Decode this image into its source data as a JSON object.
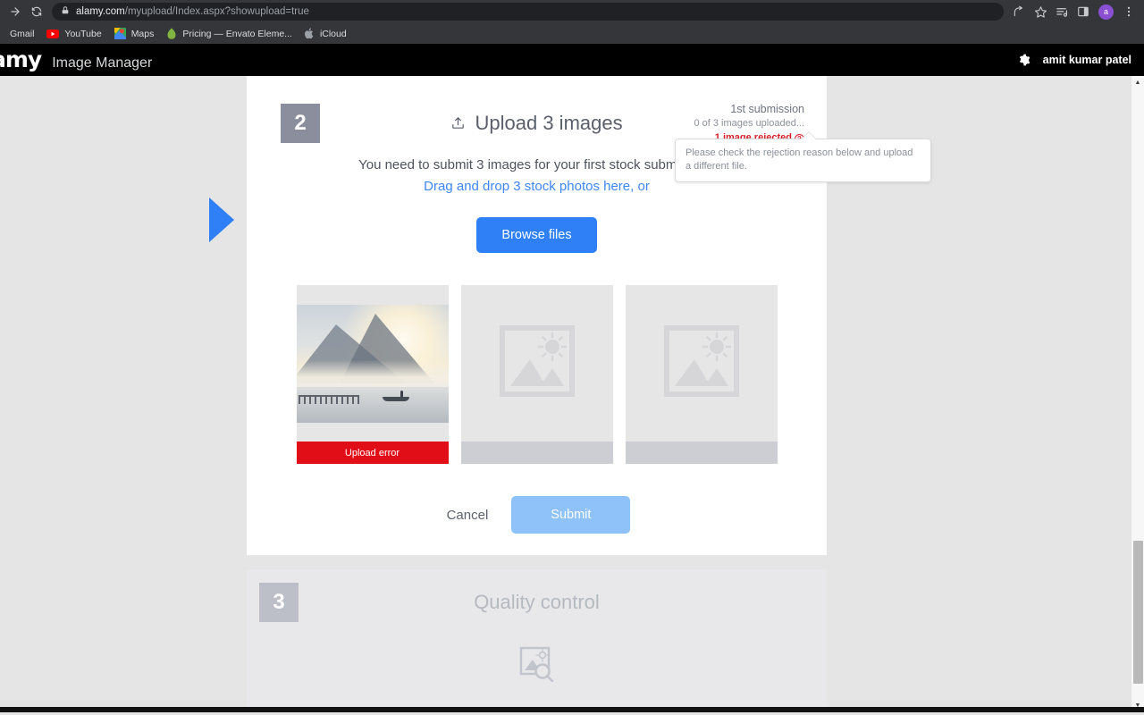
{
  "browser": {
    "nav": {
      "forward_icon": "arrow-right-icon",
      "reload_icon": "reload-icon"
    },
    "omnibox": {
      "lock_icon": "lock-icon",
      "url_domain": "alamy.com",
      "url_path": "/myupload/Index.aspx?showupload=true"
    },
    "toolbar_icons": [
      "share-icon",
      "bookmark-star-icon",
      "reading-list-icon",
      "side-panel-icon"
    ],
    "profile_initial": "a",
    "menu_icon": "three-dot-menu-icon",
    "bookmarks": [
      {
        "label": "Gmail",
        "icon": "gmail-icon"
      },
      {
        "label": "YouTube",
        "icon": "youtube-icon"
      },
      {
        "label": "Maps",
        "icon": "google-maps-icon"
      },
      {
        "label": "Pricing — Envato Eleme...",
        "icon": "envato-icon"
      },
      {
        "label": "iCloud",
        "icon": "apple-icon"
      }
    ]
  },
  "app_header": {
    "logo_text": "amy",
    "app_name": "Image Manager",
    "gear_icon": "gear-icon",
    "user_name": "amit kumar patel"
  },
  "step2": {
    "badge": "2",
    "upload_icon": "upload-icon",
    "title": "Upload 3 images",
    "status": {
      "submission": "1st submission",
      "uploaded": "0 of 3 images uploaded...",
      "rejected": "1 image rejected",
      "help_icon": "question-mark-icon"
    },
    "tooltip": "Please check the rejection reason below and upload a different file.",
    "lede_line1": "You need to submit 3 images for your first stock submission.",
    "lede_line2": "Drag and drop 3 stock photos here, or",
    "browse_label": "Browse files",
    "slots": [
      {
        "state": "error",
        "footer_label": "Upload error",
        "thumbnail": "lake-sunrise-boat-photo"
      },
      {
        "state": "empty",
        "footer_label": "",
        "placeholder_icon": "image-placeholder-icon"
      },
      {
        "state": "empty",
        "footer_label": "",
        "placeholder_icon": "image-placeholder-icon"
      }
    ],
    "cancel_label": "Cancel",
    "submit_label": "Submit"
  },
  "step3": {
    "badge": "3",
    "title": "Quality control",
    "icon": "image-inspect-icon"
  },
  "colors": {
    "accent_blue": "#2f80f7",
    "link_blue": "#3f86f5",
    "error_red": "#e10e17",
    "rejected_red": "#d8202a",
    "page_bg": "#e5e5e5",
    "badge_grey": "#8b8e9c",
    "badge_grey_disabled": "#bcbec8",
    "submit_disabled": "#8ec2f8"
  }
}
